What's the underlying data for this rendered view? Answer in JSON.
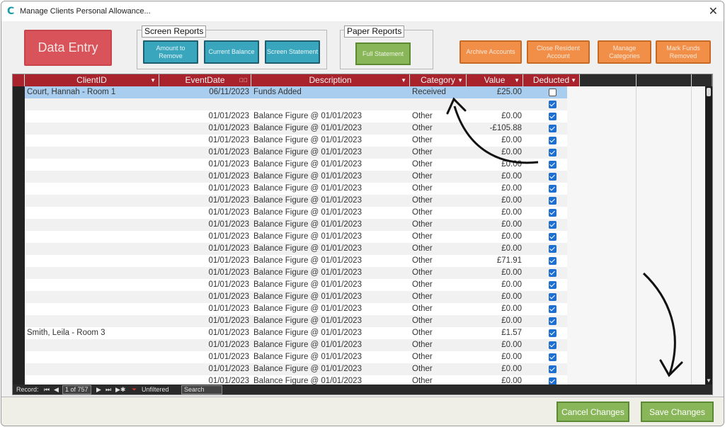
{
  "window": {
    "title": "Manage Clients Personal Allowance..."
  },
  "header": {
    "data_entry_label": "Data Entry",
    "screen_reports": {
      "label": "Screen Reports",
      "buttons": [
        "Amount to Remove",
        "Current Balance",
        "Screen Statement"
      ]
    },
    "paper_reports": {
      "label": "Paper Reports",
      "buttons": [
        "Full Statement"
      ]
    },
    "actions": [
      "Archive Accounts",
      "Close Resident Account",
      "Manage Categories",
      "Mark Funds Removed"
    ]
  },
  "grid": {
    "columns": [
      "ClientID",
      "EventDate",
      "Description",
      "Category",
      "Value",
      "Deducted"
    ],
    "rows": [
      {
        "client": "Court, Hannah - Room 1",
        "date": "06/11/2023",
        "desc": "Funds Added",
        "cat": "Received",
        "val": "£25.00",
        "ded": false,
        "selected": true
      },
      {
        "client": "",
        "date": "",
        "desc": "",
        "cat": "",
        "val": "",
        "ded": true
      },
      {
        "client": "",
        "date": "01/01/2023",
        "desc": "Balance Figure @ 01/01/2023",
        "cat": "Other",
        "val": "£0.00",
        "ded": true
      },
      {
        "client": "",
        "date": "01/01/2023",
        "desc": "Balance Figure @ 01/01/2023",
        "cat": "Other",
        "val": "-£105.88",
        "ded": true
      },
      {
        "client": "",
        "date": "01/01/2023",
        "desc": "Balance Figure @ 01/01/2023",
        "cat": "Other",
        "val": "£0.00",
        "ded": true
      },
      {
        "client": "",
        "date": "01/01/2023",
        "desc": "Balance Figure @ 01/01/2023",
        "cat": "Other",
        "val": "£0.00",
        "ded": true
      },
      {
        "client": "",
        "date": "01/01/2023",
        "desc": "Balance Figure @ 01/01/2023",
        "cat": "Other",
        "val": "£0.00",
        "ded": true
      },
      {
        "client": "",
        "date": "01/01/2023",
        "desc": "Balance Figure @ 01/01/2023",
        "cat": "Other",
        "val": "£0.00",
        "ded": true
      },
      {
        "client": "",
        "date": "01/01/2023",
        "desc": "Balance Figure @ 01/01/2023",
        "cat": "Other",
        "val": "£0.00",
        "ded": true
      },
      {
        "client": "",
        "date": "01/01/2023",
        "desc": "Balance Figure @ 01/01/2023",
        "cat": "Other",
        "val": "£0.00",
        "ded": true
      },
      {
        "client": "",
        "date": "01/01/2023",
        "desc": "Balance Figure @ 01/01/2023",
        "cat": "Other",
        "val": "£0.00",
        "ded": true
      },
      {
        "client": "",
        "date": "01/01/2023",
        "desc": "Balance Figure @ 01/01/2023",
        "cat": "Other",
        "val": "£0.00",
        "ded": true
      },
      {
        "client": "",
        "date": "01/01/2023",
        "desc": "Balance Figure @ 01/01/2023",
        "cat": "Other",
        "val": "£0.00",
        "ded": true
      },
      {
        "client": "",
        "date": "01/01/2023",
        "desc": "Balance Figure @ 01/01/2023",
        "cat": "Other",
        "val": "£0.00",
        "ded": true
      },
      {
        "client": "",
        "date": "01/01/2023",
        "desc": "Balance Figure @ 01/01/2023",
        "cat": "Other",
        "val": "£71.91",
        "ded": true
      },
      {
        "client": "",
        "date": "01/01/2023",
        "desc": "Balance Figure @ 01/01/2023",
        "cat": "Other",
        "val": "£0.00",
        "ded": true
      },
      {
        "client": "",
        "date": "01/01/2023",
        "desc": "Balance Figure @ 01/01/2023",
        "cat": "Other",
        "val": "£0.00",
        "ded": true
      },
      {
        "client": "",
        "date": "01/01/2023",
        "desc": "Balance Figure @ 01/01/2023",
        "cat": "Other",
        "val": "£0.00",
        "ded": true
      },
      {
        "client": "",
        "date": "01/01/2023",
        "desc": "Balance Figure @ 01/01/2023",
        "cat": "Other",
        "val": "£0.00",
        "ded": true
      },
      {
        "client": "",
        "date": "01/01/2023",
        "desc": "Balance Figure @ 01/01/2023",
        "cat": "Other",
        "val": "£0.00",
        "ded": true
      },
      {
        "client": "Smith, Leila - Room 3",
        "date": "01/01/2023",
        "desc": "Balance Figure @ 01/01/2023",
        "cat": "Other",
        "val": "£1.57",
        "ded": true
      },
      {
        "client": "",
        "date": "01/01/2023",
        "desc": "Balance Figure @ 01/01/2023",
        "cat": "Other",
        "val": "£0.00",
        "ded": true
      },
      {
        "client": "",
        "date": "01/01/2023",
        "desc": "Balance Figure @ 01/01/2023",
        "cat": "Other",
        "val": "£0.00",
        "ded": true
      },
      {
        "client": "",
        "date": "01/01/2023",
        "desc": "Balance Figure @ 01/01/2023",
        "cat": "Other",
        "val": "£0.00",
        "ded": true
      },
      {
        "client": "",
        "date": "01/01/2023",
        "desc": "Balance Figure @ 01/01/2023",
        "cat": "Other",
        "val": "£0.00",
        "ded": true
      }
    ]
  },
  "navigation": {
    "record_label": "Record:",
    "position": "1 of 757",
    "filter_status": "Unfiltered",
    "search_placeholder": "Search"
  },
  "footer": {
    "cancel_label": "Cancel Changes",
    "save_label": "Save Changes"
  },
  "colors": {
    "header_red": "#a9232d",
    "teal": "#3aa6bd",
    "green": "#8ab65a",
    "orange": "#f18f48",
    "selection_blue": "#a9cdee",
    "checkbox_blue": "#1f6fd1"
  }
}
